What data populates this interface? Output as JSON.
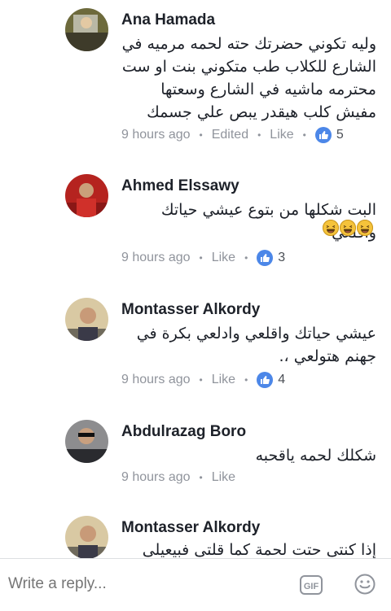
{
  "comments": [
    {
      "name": "Ana Hamada",
      "text": "وليه تكوني حضرتك حته لحمه مرميه في الشارع للكلاب طب متكوني بنت او ست محترمه ماشيه في الشارع وسعتها مفيش كلب هيقدر يبص علي جسمك",
      "time": "9 hours ago",
      "edited": "Edited",
      "like": "Like",
      "reactions": "5"
    },
    {
      "name": "Ahmed Elssawy",
      "text": "البت شكلها من بتوع عيشي حياتك واقلعي",
      "time": "9 hours ago",
      "like": "Like",
      "reactions": "3"
    },
    {
      "name": "Montasser Alkordy",
      "text": "عيشي حياتك واقلعي وادلعي بكرة في جهنم هتولعي ،.",
      "time": "9 hours ago",
      "like": "Like",
      "reactions": "4"
    },
    {
      "name": "Abdulrazag Boro",
      "text": "شكلك لحمه ياقحبه",
      "time": "9 hours ago",
      "like": "Like"
    },
    {
      "name": "Montasser Alkordy",
      "text": "إذا كنتى حتت لحمة كما قلتى فبيعيلى"
    }
  ],
  "reply": {
    "placeholder": "Write a reply...",
    "gif_label": "GIF"
  },
  "colors": {
    "like_badge": "#4c87e8",
    "meta_text": "#90949c"
  }
}
